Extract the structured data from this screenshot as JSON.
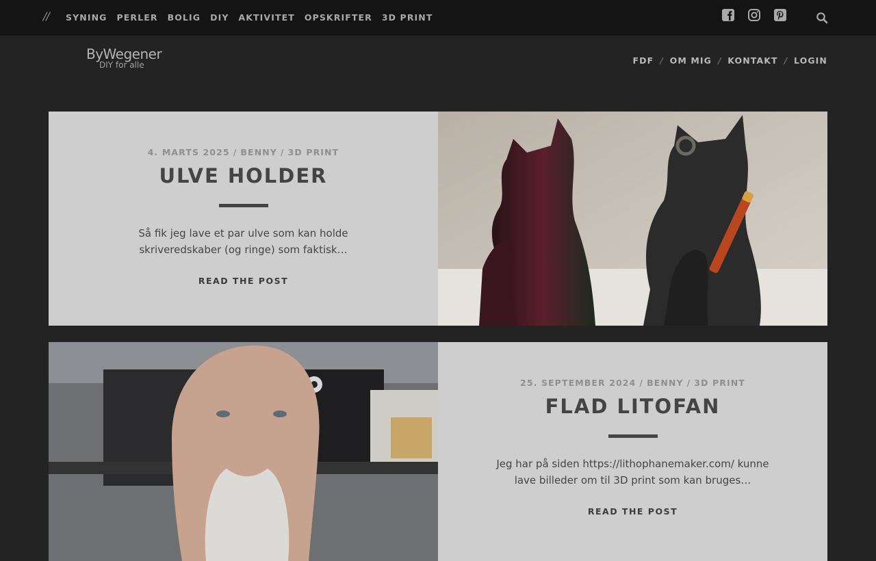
{
  "topbar": {
    "decor": "//",
    "nav": [
      "SYNING",
      "PERLER",
      "BOLIG",
      "DIY",
      "AKTIVITET",
      "OPSKRIFTER",
      "3D PRINT"
    ],
    "social_icons": [
      "facebook-square-icon",
      "instagram-icon",
      "pinterest-square-icon"
    ],
    "search_icon": "search-icon"
  },
  "header": {
    "logo_line1": "ByWegener",
    "logo_line2": "DIY for alle",
    "secondary_nav": [
      "FDF",
      "OM MIG",
      "KONTAKT",
      "LOGIN"
    ]
  },
  "posts": [
    {
      "date": "4. MARTS 2025",
      "author": "BENNY",
      "category": "3D PRINT",
      "title": "ULVE HOLDER",
      "excerpt": "Så fik jeg lave et par ulve som kan holde skriveredskaber (og ringe) som faktisk…",
      "read_more": "READ THE POST"
    },
    {
      "date": "25. SEPTEMBER 2024",
      "author": "BENNY",
      "category": "3D PRINT",
      "title": "FLAD LITOFAN",
      "excerpt": "Jeg har på siden https://lithophanemaker.com/ kunne lave billeder om til 3D print som kan bruges…",
      "read_more": "READ THE POST"
    }
  ],
  "colors": {
    "topbar_bg": "#141414",
    "page_bg": "#232323",
    "card_bg": "#cecece",
    "title_text": "#444444",
    "meta_text": "#8f8f8f"
  }
}
